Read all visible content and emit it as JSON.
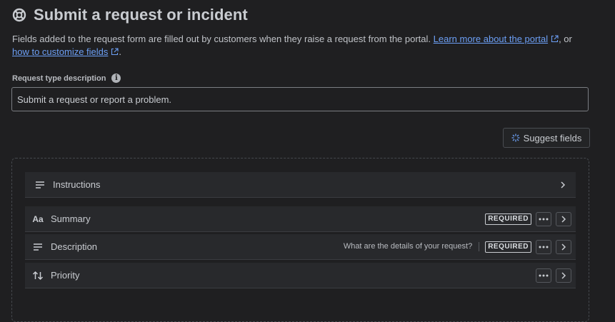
{
  "header": {
    "title": "Submit a request or incident",
    "icon": "lifebuoy-icon"
  },
  "intro": {
    "text_before": "Fields added to the request form are filled out by customers when they raise a request from the portal. ",
    "link_portal": "Learn more about the portal",
    "text_middle": ", or",
    "link_customize": "how to customize fields",
    "text_end": "."
  },
  "description_field": {
    "label": "Request type description",
    "value": "Submit a request or report a problem."
  },
  "suggest_button": {
    "label": "Suggest fields"
  },
  "fields": [
    {
      "label": "Instructions",
      "icon": "lines-icon"
    },
    {
      "label": "Summary",
      "icon": "text-type-icon",
      "icon_glyph": "Aa",
      "badge": "REQUIRED"
    },
    {
      "label": "Description",
      "icon": "lines-icon",
      "hint": "What are the details of your request?",
      "badge": "REQUIRED"
    },
    {
      "label": "Priority",
      "icon": "sort-arrows-icon"
    }
  ],
  "colors": {
    "background": "#1f1f21",
    "row": "#28292c",
    "link": "#6c9ff5",
    "text": "#c9ccd1"
  }
}
